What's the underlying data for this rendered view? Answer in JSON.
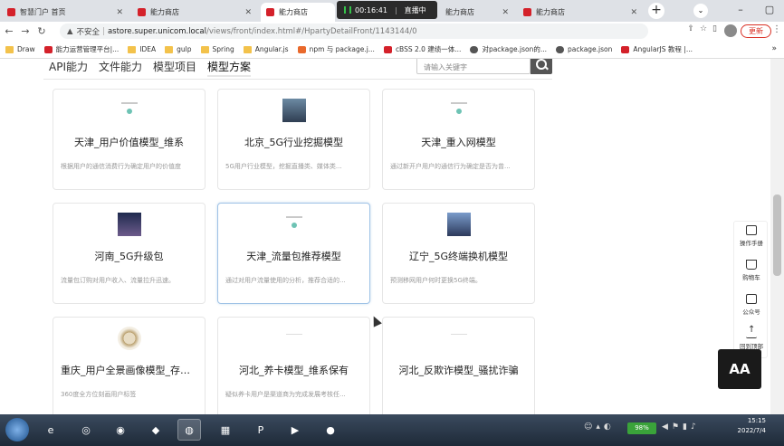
{
  "tabs": [
    {
      "title": "智慧门户 首页",
      "active": false
    },
    {
      "title": "能力商店",
      "active": false
    },
    {
      "title": "能力商店",
      "active": true
    },
    {
      "title": "能力商店",
      "active": false
    },
    {
      "title": "能力商店",
      "active": false
    }
  ],
  "live": {
    "time": "00:16:41",
    "status": "直播中"
  },
  "address": {
    "warning": "不安全",
    "host": "astore.super.unicom.local",
    "path": "/views/front/index.html#/HpartyDetailFront/1143144/0"
  },
  "update_label": "更新",
  "bookmarks": [
    "Draw",
    "能力运营管理平台|...",
    "IDEA",
    "gulp",
    "Spring",
    "Angular.js",
    "npm 与 package.j...",
    "cBSS 2.0 建绩一体...",
    "对package.json的...",
    "package.json",
    "AngularJS 教程 |..."
  ],
  "subnav": {
    "tabs": [
      "API能力",
      "文件能力",
      "模型项目",
      "模型方案"
    ],
    "active": "模型方案"
  },
  "search": {
    "placeholder": "请输入关键字"
  },
  "cards": [
    {
      "title": "天津_用户价值模型_维系",
      "desc": "根据用户的通信消费行为确定用户的价值度",
      "thumb": "logo"
    },
    {
      "title": "北京_5G行业挖掘模型",
      "desc": "5G用户行业模型，挖掘直播类、媒体类...",
      "thumb": "city1"
    },
    {
      "title": "天津_重入网模型",
      "desc": "通过新开户用户的通信行为确定是否为曾...",
      "thumb": "logo"
    },
    {
      "title": "河南_5G升级包",
      "desc": "流量包订购对用户收入、流量拉升迅速。",
      "thumb": "city2"
    },
    {
      "title": "天津_流量包推荐模型",
      "desc": "通过对用户流量使用的分析，推荐合适的...",
      "thumb": "logo"
    },
    {
      "title": "辽宁_5G终端换机模型",
      "desc": "预测移网用户何时更换5G终端。",
      "thumb": "city3"
    },
    {
      "title": "重庆_用户全景画像模型_存量...",
      "desc": "360度全方位刻画用户标签",
      "thumb": "seal"
    },
    {
      "title": "河北_养卡模型_维系保有",
      "desc": "疑似养卡用户是渠道商为完成发展考核任...",
      "thumb": "blank"
    },
    {
      "title": "河北_反欺诈模型_骚扰诈骗",
      "desc": "",
      "thumb": "blank"
    }
  ],
  "right_panel": [
    "操作手册",
    "购物车",
    "公众号",
    "回到顶部"
  ],
  "brand_badge": "AA",
  "taskbar": {
    "battery": "98%",
    "time": "15:15",
    "date": "2022/7/4"
  }
}
